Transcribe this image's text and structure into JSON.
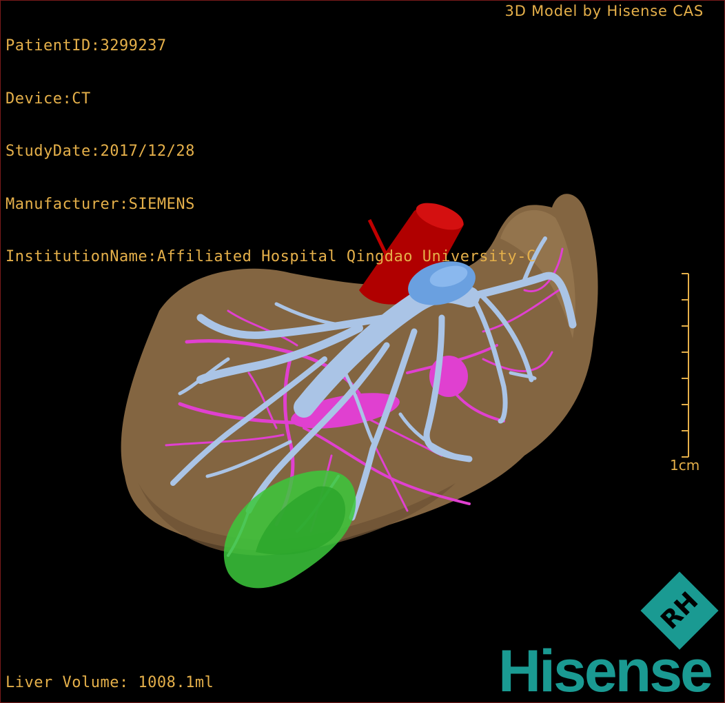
{
  "header": {
    "patient_id": "PatientID:3299237",
    "device": "Device:CT",
    "study_date": "StudyDate:2017/12/28",
    "manufacturer": "Manufacturer:SIEMENS",
    "institution": "InstitutionName:Affiliated Hospital Qingdao University-C",
    "credit": "3D Model by Hisense CAS"
  },
  "footer": {
    "liver_volume": "Liver Volume: 1008.1ml"
  },
  "scale_bar": {
    "label": "1cm"
  },
  "logo": {
    "badge": "RH",
    "brand": "Hisense"
  },
  "colors": {
    "text": "#e5b04a",
    "liver": "#8a6a45",
    "aorta": "#c00000",
    "portal_vein": "#aac4e6",
    "ivc": "#6aa0e0",
    "hepatic_artery": "#e040d0",
    "gallbladder": "#3cc83c",
    "brand": "#1a9a92"
  }
}
